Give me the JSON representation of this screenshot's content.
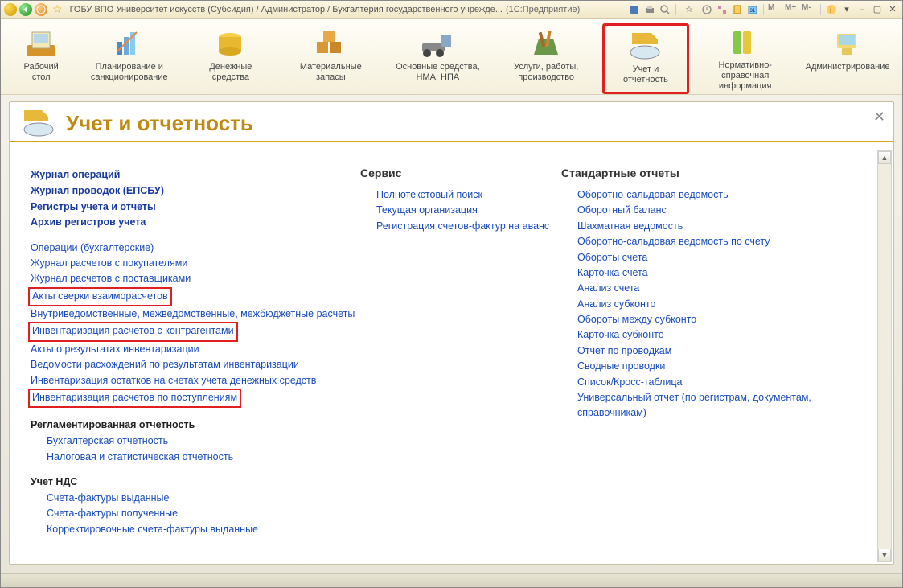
{
  "titlebar": {
    "title": "ГОБУ ВПО Университет искусств (Субсидия) / Администратор / Бухгалтерия государственного учрежде...",
    "app": "(1С:Предприятие)",
    "m": "M",
    "mplus": "M+",
    "mminus": "M-"
  },
  "toolbar": {
    "items": [
      {
        "label": "Рабочий стол"
      },
      {
        "label": "Планирование и санкционирование"
      },
      {
        "label": "Денежные средства"
      },
      {
        "label": "Материальные запасы"
      },
      {
        "label": "Основные средства, НМА, НПА"
      },
      {
        "label": "Услуги, работы, производство"
      },
      {
        "label": "Учет и отчетность"
      },
      {
        "label": "Нормативно-справочная информация"
      },
      {
        "label": "Администрирование"
      }
    ],
    "selected_index": 6
  },
  "page": {
    "title": "Учет и отчетность"
  },
  "col1": {
    "top_bold": [
      "Журнал операций",
      "Журнал проводок (ЕПСБУ)",
      "Регистры учета и отчеты",
      "Архив регистров учета"
    ],
    "main": [
      {
        "text": "Операции (бухгалтерские)"
      },
      {
        "text": "Журнал расчетов с покупателями"
      },
      {
        "text": "Журнал расчетов с поставщиками"
      },
      {
        "text": "Акты сверки взаиморасчетов",
        "boxed": true
      },
      {
        "text": "Внутриведомственные, межведомственные, межбюджетные расчеты"
      },
      {
        "text": "Инвентаризация расчетов с контрагентами",
        "boxed": true
      },
      {
        "text": "Акты о результатах инвентаризации"
      },
      {
        "text": "Ведомости расхождений по результатам инвентаризации"
      },
      {
        "text": "Инвентаризация остатков на счетах учета денежных средств"
      },
      {
        "text": "Инвентаризация расчетов по поступлениям",
        "boxed": true
      }
    ],
    "reglament_title": "Регламентированная отчетность",
    "reglament": [
      "Бухгалтерская отчетность",
      "Налоговая и статистическая отчетность"
    ],
    "nds_title": "Учет НДС",
    "nds": [
      "Счета-фактуры выданные",
      "Счета-фактуры полученные",
      "Корректировочные счета-фактуры выданные"
    ]
  },
  "col2": {
    "title": "Сервис",
    "items": [
      "Полнотекстовый поиск",
      "Текущая организация",
      "Регистрация счетов-фактур на аванс"
    ]
  },
  "col3": {
    "title": "Стандартные отчеты",
    "items": [
      "Оборотно-сальдовая ведомость",
      "Оборотный баланс",
      "Шахматная ведомость",
      "Оборотно-сальдовая ведомость по счету",
      "Обороты счета",
      "Карточка счета",
      "Анализ счета",
      "Анализ субконто",
      "Обороты между субконто",
      "Карточка субконто",
      "Отчет по проводкам",
      "Сводные проводки",
      "Список/Кросс-таблица",
      "Универсальный отчет (по регистрам, документам, справочникам)"
    ]
  }
}
